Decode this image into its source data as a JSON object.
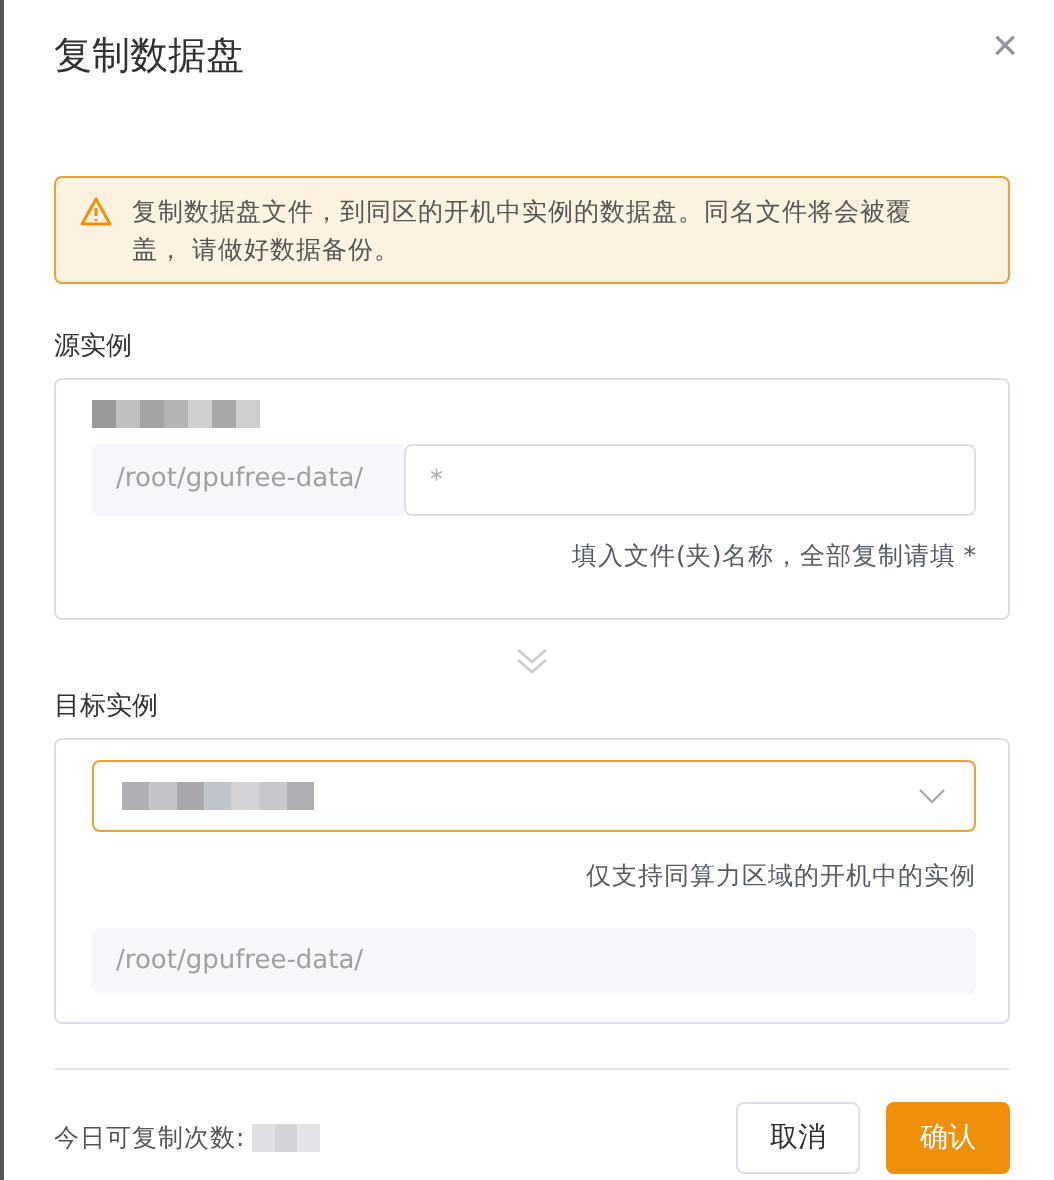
{
  "dialog": {
    "title": "复制数据盘",
    "close": "×"
  },
  "alert": {
    "text": "复制数据盘文件，到同区的开机中实例的数据盘。同名文件将会被覆盖， 请做好数据备份。"
  },
  "source": {
    "label": "源实例",
    "prefix": "/root/gpufree-data/",
    "placeholder": "*",
    "hint": "填入文件(夹)名称，全部复制请填 *"
  },
  "target": {
    "label": "目标实例",
    "focused": true,
    "hint": "仅支持同算力区域的开机中的实例",
    "path": "/root/gpufree-data/"
  },
  "footer": {
    "quota_label": "今日可复制次数:",
    "buttons": [
      {
        "label": "取消",
        "kind": "secondary"
      },
      {
        "label": "确认",
        "kind": "primary"
      }
    ]
  }
}
